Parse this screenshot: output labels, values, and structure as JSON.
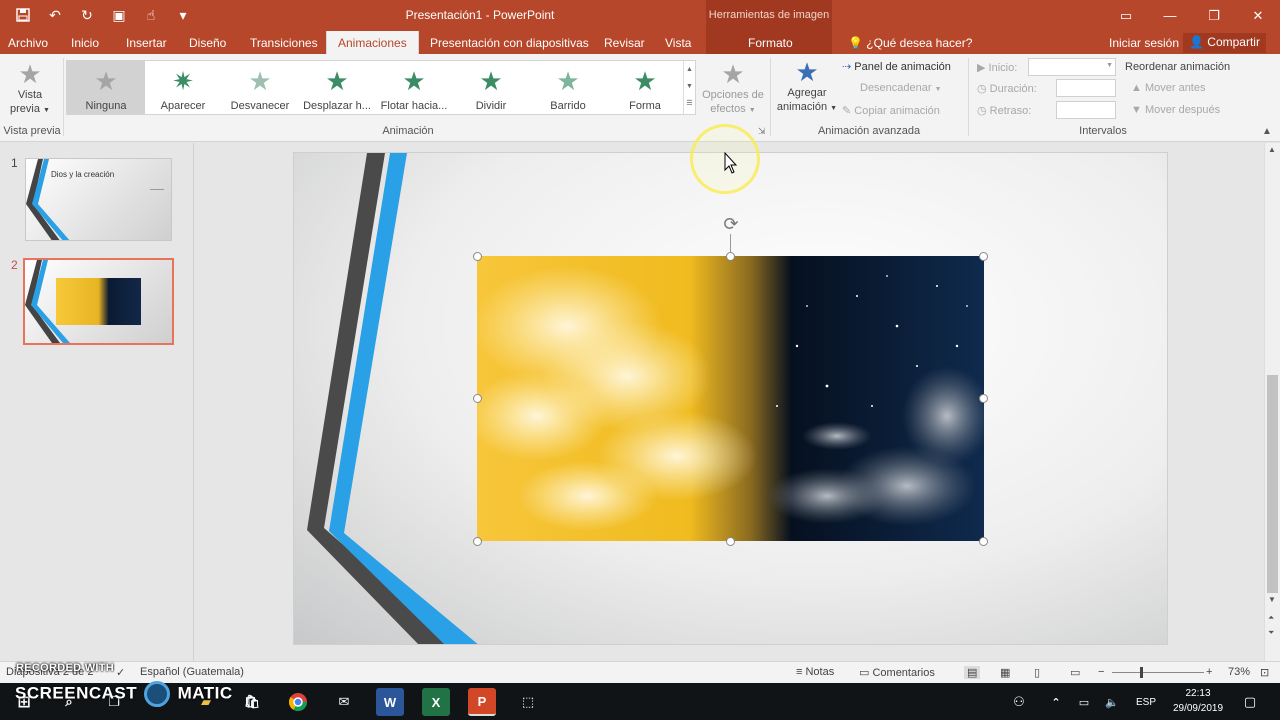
{
  "app": {
    "document_title": "Presentación1 - PowerPoint",
    "tools_header": "Herramientas de imagen"
  },
  "tabs": [
    "Archivo",
    "Inicio",
    "Insertar",
    "Diseño",
    "Transiciones",
    "Animaciones",
    "Presentación con diapositivas",
    "Revisar",
    "Vista",
    "Formato"
  ],
  "active_tab": "Animaciones",
  "tell_me": "¿Qué desea hacer?",
  "account": {
    "signin": "Iniciar sesión",
    "share": "Compartir"
  },
  "ribbon": {
    "preview": {
      "label_line1": "Vista",
      "label_line2": "previa",
      "group": "Vista previa"
    },
    "animation_group": "Animación",
    "animations": [
      "Ninguna",
      "Aparecer",
      "Desvanecer",
      "Desplazar h...",
      "Flotar hacia...",
      "Dividir",
      "Barrido",
      "Forma"
    ],
    "selected_animation": "Ninguna",
    "effects": {
      "line1": "Opciones de",
      "line2": "efectos"
    },
    "add_animation": {
      "line1": "Agregar",
      "line2": "animación"
    },
    "advanced": {
      "group": "Animación avanzada",
      "panel": "Panel de animación",
      "trigger": "Desencadenar",
      "copy": "Copiar animación"
    },
    "timing": {
      "group": "Intervalos",
      "start": "Inicio:",
      "duration": "Duración:",
      "delay": "Retraso:",
      "reorder": "Reordenar animación",
      "move_earlier": "Mover antes",
      "move_later": "Mover después"
    }
  },
  "slides": [
    {
      "number": "1",
      "title": "Dios y la creación"
    },
    {
      "number": "2",
      "title": ""
    }
  ],
  "statusbar": {
    "slide_info": "Diapositiva 2 de 2",
    "language": "Español (Guatemala)",
    "notes": "Notas",
    "comments": "Comentarios",
    "zoom": "73%"
  },
  "taskbar": {
    "language": "ESP",
    "time": "22:13",
    "date": "29/09/2019"
  },
  "watermark": {
    "line1": "RECORDED WITH",
    "line2": "SCREENCAST",
    "line3": "MATIC"
  },
  "colors": {
    "accent": "#b7472a",
    "tools_tab": "#a0391f",
    "slide_blue": "#2aa0e6"
  }
}
